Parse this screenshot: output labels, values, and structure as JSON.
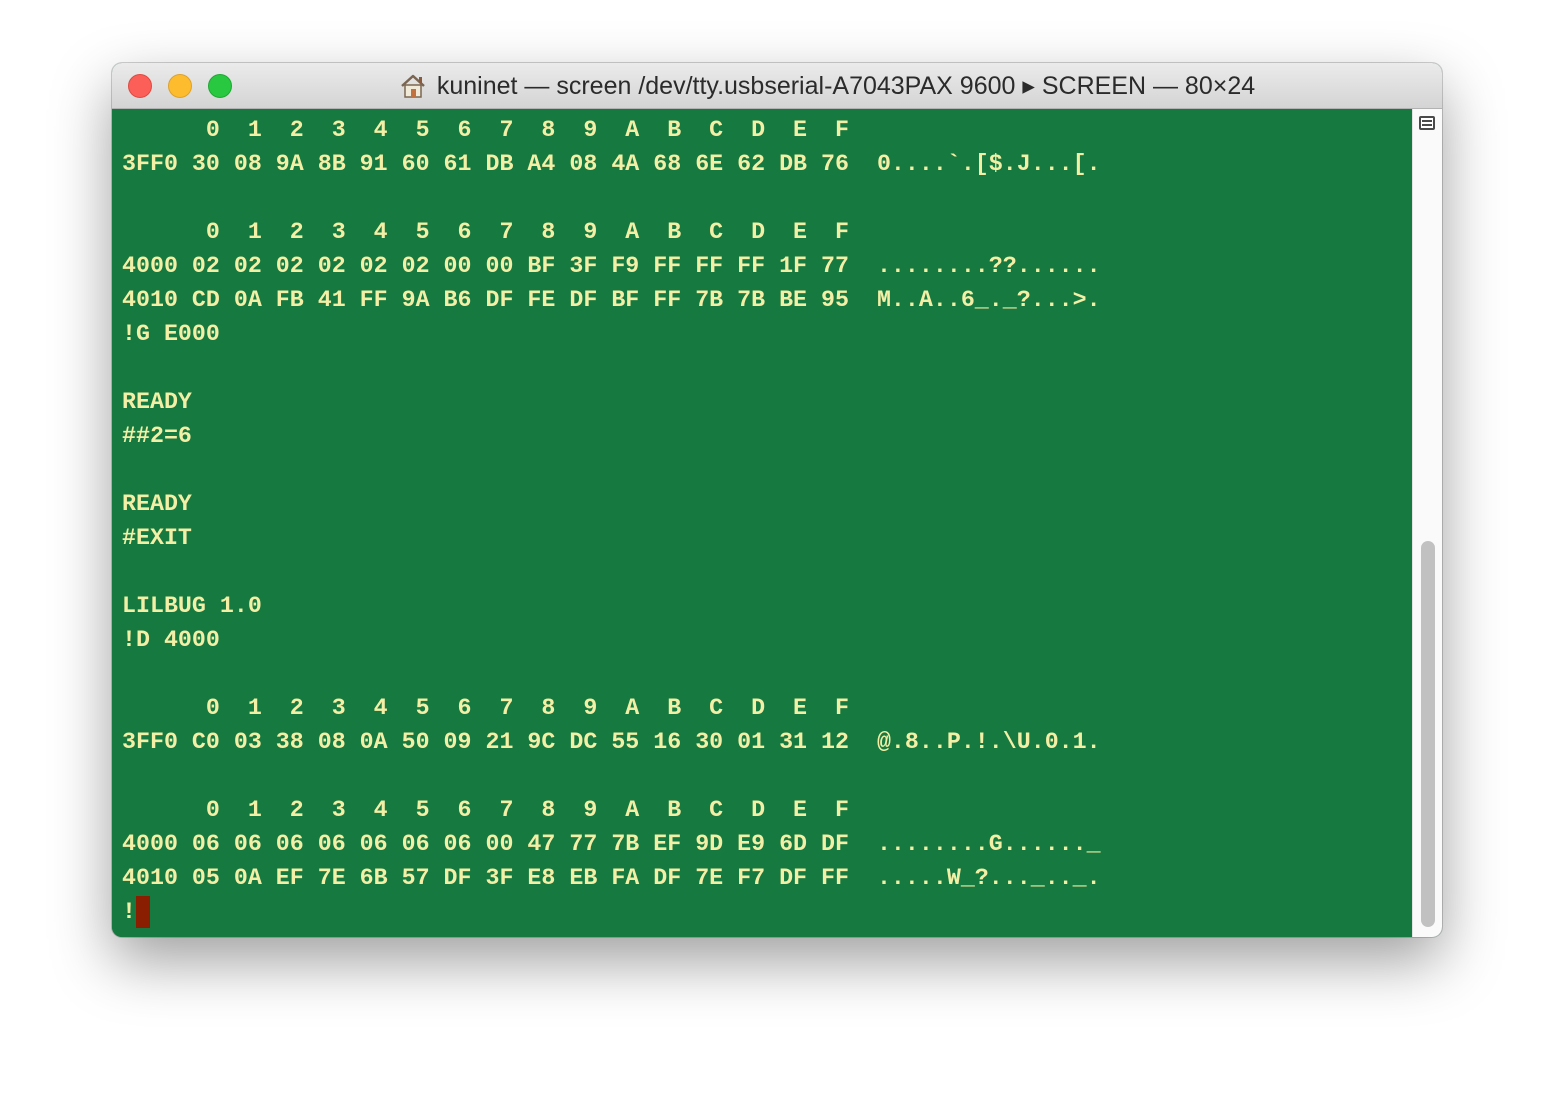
{
  "window": {
    "title": "kuninet — screen /dev/tty.usbserial-A7043PAX 9600 ▸ SCREEN — 80×24",
    "title_icon": "home-folder-icon"
  },
  "terminal": {
    "lines": [
      "      0  1  2  3  4  5  6  7  8  9  A  B  C  D  E  F",
      "3FF0 30 08 9A 8B 91 60 61 DB A4 08 4A 68 6E 62 DB 76  0....`.[$.J...[.",
      "",
      "      0  1  2  3  4  5  6  7  8  9  A  B  C  D  E  F",
      "4000 02 02 02 02 02 02 00 00 BF 3F F9 FF FF FF 1F 77  ........??......",
      "4010 CD 0A FB 41 FF 9A B6 DF FE DF BF FF 7B 7B BE 95  M..A..6_._?...>.",
      "!G E000",
      "",
      "READY",
      "##2=6",
      "",
      "READY",
      "#EXIT",
      "",
      "LILBUG 1.0",
      "!D 4000",
      "",
      "      0  1  2  3  4  5  6  7  8  9  A  B  C  D  E  F",
      "3FF0 C0 03 38 08 0A 50 09 21 9C DC 55 16 30 01 31 12  @.8..P.!.\\U.0.1.",
      "",
      "      0  1  2  3  4  5  6  7  8  9  A  B  C  D  E  F",
      "4000 06 06 06 06 06 06 06 00 47 77 7B EF 9D E9 6D DF  ........G......_",
      "4010 05 0A EF 7E 6B 57 DF 3F E8 EB FA DF 7E F7 DF FF  .....W_?..._.._.",
      "!"
    ],
    "colors": {
      "background": "#157940",
      "foreground": "#f3efa6",
      "cursor": "#8a1e00"
    }
  }
}
